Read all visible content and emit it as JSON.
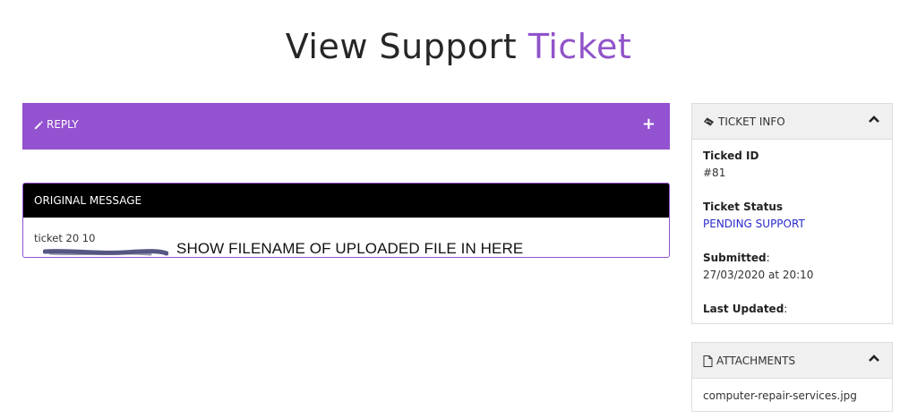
{
  "page": {
    "title_main": "View Support",
    "title_accent": "Ticket"
  },
  "reply": {
    "label": "REPLY",
    "expand_symbol": "+"
  },
  "original_message": {
    "header": "ORIGINAL MESSAGE",
    "text": "ticket 20 10",
    "annotation": "SHOW FILENAME OF UPLOADED FILE IN HERE"
  },
  "ticket_info": {
    "header": "TICKET INFO",
    "id_label": "Ticked ID",
    "id_value": "#81",
    "status_label": "Ticket Status",
    "status_value": "PENDING SUPPORT",
    "submitted_label": "Submitted",
    "submitted_value": "27/03/2020 at 20:10",
    "updated_label": "Last Updated",
    "colon": ":"
  },
  "attachments": {
    "header": "ATTACHMENTS",
    "files": [
      "computer-repair-services.jpg"
    ]
  },
  "colors": {
    "accent": "#9352cf",
    "header_black": "#000000",
    "status_blue": "#2a2acc"
  },
  "icons": {
    "reply": "pencil-icon",
    "ticket_info": "ticket-icon",
    "attachments": "file-icon",
    "collapse": "chevron-up-icon"
  }
}
